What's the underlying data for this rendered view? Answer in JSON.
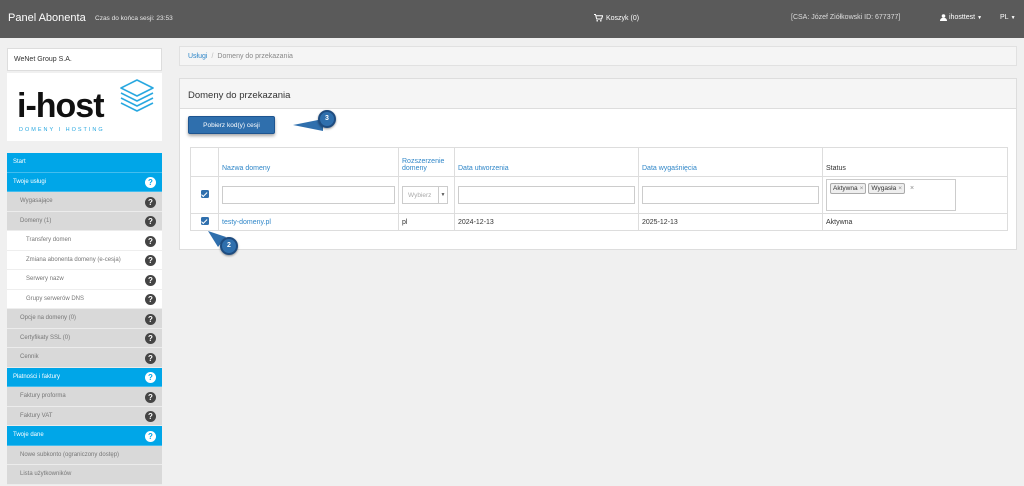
{
  "topbar": {
    "brand": "Panel Abonenta",
    "session": "Czas do końca sesji: 23:53",
    "cart_label": "Koszyk (0)",
    "csa": "[CSA: Józef Ziółkowski ID: 677377]",
    "user": "ihosttest",
    "lang": "PL"
  },
  "sidebar": {
    "company": "WeNet Group S.A.",
    "logo_text": "i-host",
    "logo_sub": "DOMENY I HOSTING",
    "items": [
      {
        "label": "Start",
        "type": "header",
        "help": false
      },
      {
        "label": "Twoje usługi",
        "type": "header",
        "help": true
      },
      {
        "label": "Wygasające",
        "type": "sub",
        "help": true
      },
      {
        "label": "Domeny (1)",
        "type": "sub",
        "help": true
      },
      {
        "label": "Transfery domen",
        "type": "subsub",
        "help": true
      },
      {
        "label": "Zmiana abonenta domeny (e-cesja)",
        "type": "subsub",
        "help": true
      },
      {
        "label": "Serwery nazw",
        "type": "subsub",
        "help": true
      },
      {
        "label": "Grupy serwerów DNS",
        "type": "subsub",
        "help": true
      },
      {
        "label": "Opcje na domeny (0)",
        "type": "sub",
        "help": true
      },
      {
        "label": "Certyfikaty SSL (0)",
        "type": "sub",
        "help": true
      },
      {
        "label": "Cennik",
        "type": "sub",
        "help": true
      },
      {
        "label": "Płatności i faktury",
        "type": "header",
        "help": true
      },
      {
        "label": "Faktury proforma",
        "type": "sub",
        "help": true
      },
      {
        "label": "Faktury VAT",
        "type": "sub",
        "help": true
      },
      {
        "label": "Twoje dane",
        "type": "header",
        "help": true
      },
      {
        "label": "Nowe subkonto (ograniczony dostęp)",
        "type": "sub",
        "help": false
      },
      {
        "label": "Lista użytkowników",
        "type": "sub",
        "help": false
      }
    ]
  },
  "breadcrumb": {
    "link": "Usługi",
    "separator": "/",
    "current": "Domeny do przekazania"
  },
  "panel": {
    "title": "Domeny do przekazania",
    "fetch_button": "Pobierz kod(y) cesji",
    "callout_button": "3",
    "callout_row": "2"
  },
  "table": {
    "headers": {
      "name": "Nazwa domeny",
      "ext": "Rozszerzenie domeny",
      "created": "Data utworzenia",
      "expires": "Data wygaśnięcia",
      "status": "Status"
    },
    "filters": {
      "ext_select": "Wybierz",
      "status_tags": [
        "Aktywna",
        "Wygasła"
      ],
      "tag_remove": "×",
      "clear": "×"
    },
    "rows": [
      {
        "name": "testy-domeny.pl",
        "ext": "pl",
        "created": "2024-12-13",
        "expires": "2025-12-13",
        "status": "Aktywna",
        "checked": true
      }
    ]
  },
  "colors": {
    "topbar": "#5a5a5a",
    "accent": "#00a6e8",
    "button": "#2f6fad",
    "link": "#2f86c8"
  },
  "icons": {
    "cart": "cart-icon",
    "user": "user-icon",
    "help": "question-circle-icon",
    "logo": "stacked-layers-icon"
  }
}
